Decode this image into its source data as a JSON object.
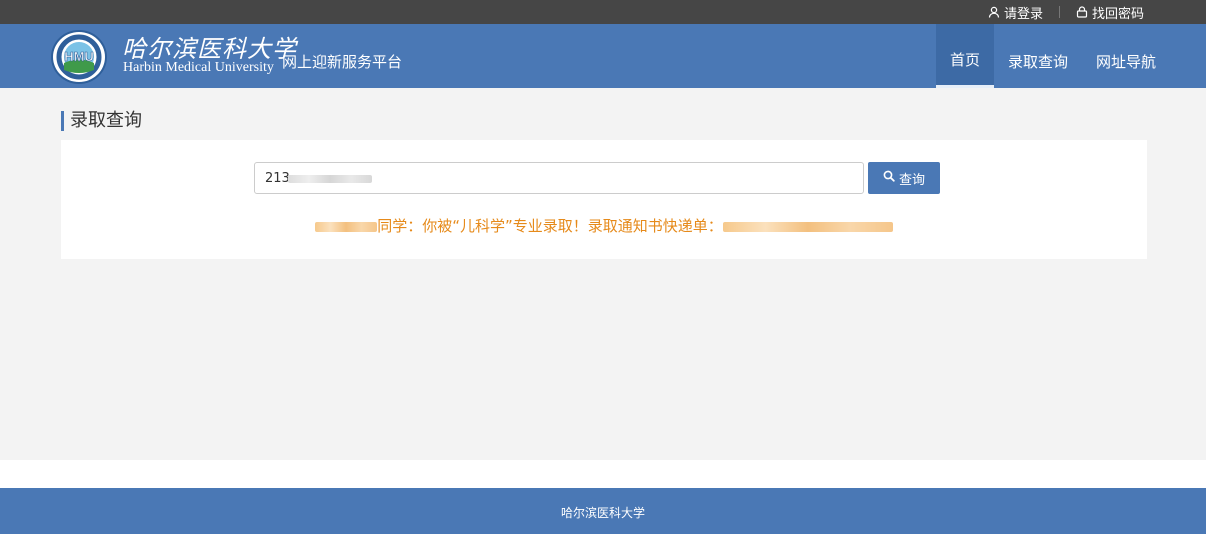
{
  "topbar": {
    "login_label": "请登录",
    "find_password_label": "找回密码"
  },
  "header": {
    "logo_text": "HMU",
    "logo_script": "哈尔滨医科大学",
    "logo_english": "Harbin Medical University",
    "platform_name": "网上迎新服务平台",
    "nav": [
      {
        "label": "首页",
        "active": true
      },
      {
        "label": "录取查询",
        "active": false
      },
      {
        "label": "网址导航",
        "active": false
      }
    ]
  },
  "main": {
    "section_title": "录取查询",
    "search": {
      "value_visible": "213",
      "button_label": "查询",
      "icon": "search-icon"
    },
    "result": {
      "text_middle": "同学：你被“儿科学”专业录取！录取通知书快递单："
    }
  },
  "footer": {
    "text": "哈尔滨医科大学"
  },
  "colors": {
    "topbar": "#464646",
    "brand": "#4a78b5",
    "result": "#e68a1a",
    "background": "#f3f3f3"
  }
}
